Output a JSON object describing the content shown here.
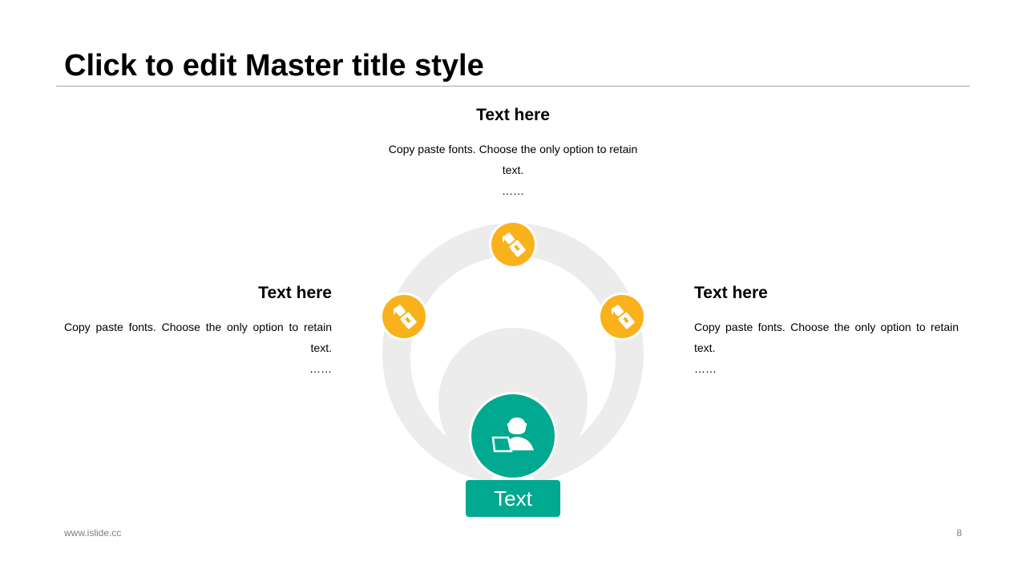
{
  "slide": {
    "title": "Click to edit Master title style",
    "footer_url": "www.islide.cc",
    "page_number": "8"
  },
  "blocks": {
    "top": {
      "heading": "Text here",
      "body": "Copy paste fonts. Choose the only option to retain text.",
      "dots": "……"
    },
    "left": {
      "heading": "Text here",
      "body": "Copy paste fonts. Choose the only option to retain text.",
      "dots": "……"
    },
    "right": {
      "heading": "Text here",
      "body": "Copy paste fonts. Choose the only option to retain text.",
      "dots": "……"
    }
  },
  "center": {
    "label": "Text",
    "icon": "person-laptop-icon"
  },
  "nodes": [
    {
      "id": "left",
      "icon": "seatbelt-buckle-icon"
    },
    {
      "id": "top",
      "icon": "seatbelt-buckle-icon"
    },
    {
      "id": "right",
      "icon": "seatbelt-buckle-icon"
    }
  ],
  "colors": {
    "accent_green": "#00a98f",
    "accent_yellow": "#f9b21c",
    "ring_gray": "#ececec",
    "rule_gray": "#a6a6a6",
    "footer_gray": "#7f7f7f"
  }
}
